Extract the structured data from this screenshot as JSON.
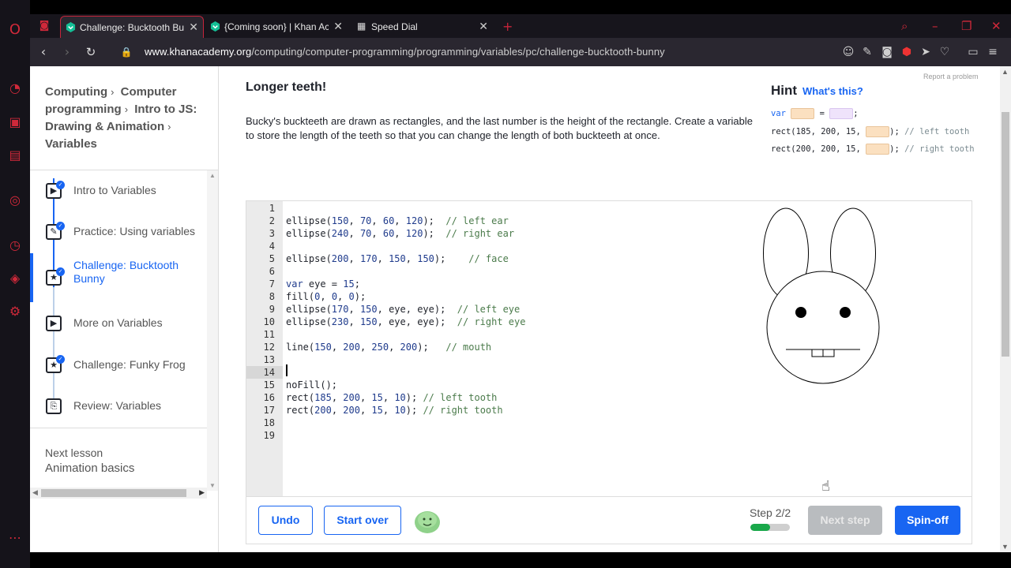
{
  "browser": {
    "tabs": [
      {
        "title": "Challenge: Bucktooth Bunny",
        "active": true
      },
      {
        "title": "{Coming soon} | Khan Academy",
        "active": false
      },
      {
        "title": "Speed Dial",
        "active": false
      }
    ],
    "new_tab_icon": "plus-icon",
    "url_host": "www.khanacademy.org",
    "url_path": "/computing/computer-programming/programming/variables/pc/challenge-bucktooth-bunny",
    "accent_color": "#c7243a"
  },
  "breadcrumb": [
    "Computing",
    "Computer programming",
    "Intro to JS: Drawing & Animation",
    "Variables"
  ],
  "lessons": [
    {
      "label": "Intro to Variables",
      "icon": "play-icon",
      "done": true
    },
    {
      "label": "Practice: Using variables",
      "icon": "pencil-icon",
      "done": true
    },
    {
      "label": "Challenge: Bucktooth Bunny",
      "icon": "star-icon",
      "done": true,
      "current": true
    },
    {
      "label": "More on Variables",
      "icon": "play-icon",
      "done": false
    },
    {
      "label": "Challenge: Funky Frog",
      "icon": "star-icon",
      "done": true
    },
    {
      "label": "Review: Variables",
      "icon": "document-icon",
      "done": false
    }
  ],
  "next_lesson": {
    "label": "Next lesson",
    "title": "Animation basics"
  },
  "challenge": {
    "title": "Longer teeth!",
    "description": "Bucky's buckteeth are drawn as rectangles, and the last number is the height of the rectangle. Create a variable to store the length of the teeth so that you can change the length of both buckteeth at once.",
    "report": "Report a problem"
  },
  "hint": {
    "title": "Hint",
    "whats_this": "What's this?",
    "line1_kw": "var",
    "line1_eq": "=",
    "line1_end": ";",
    "line2_code": "rect(185, 200, 15,",
    "line2_end": ");",
    "line2_comment": "// left tooth",
    "line3_code": "rect(200, 200, 15,",
    "line3_end": ");",
    "line3_comment": "// right tooth"
  },
  "editor": {
    "line_numbers": [
      "1",
      "2",
      "3",
      "4",
      "5",
      "6",
      "7",
      "8",
      "9",
      "10",
      "11",
      "12",
      "13",
      "14",
      "15",
      "16",
      "17",
      "18",
      "19"
    ],
    "active_line": 14,
    "lines": [
      "",
      "ellipse(150, 70, 60, 120);  // left ear",
      "ellipse(240, 70, 60, 120);  // right ear",
      "",
      "ellipse(200, 170, 150, 150);    // face",
      "",
      "var eye = 15;",
      "fill(0, 0, 0);",
      "ellipse(170, 150, eye, eye);  // left eye",
      "ellipse(230, 150, eye, eye);  // right eye",
      "",
      "line(150, 200, 250, 200);   // mouth",
      "",
      "",
      "noFill();",
      "rect(185, 200, 15, 10); // left tooth",
      "rect(200, 200, 15, 10); // right tooth",
      "",
      ""
    ]
  },
  "toolbar": {
    "undo": "Undo",
    "start_over": "Start over",
    "step_label": "Step 2/2",
    "step_progress": 0.5,
    "next_step": "Next step",
    "spin_off": "Spin-off"
  }
}
